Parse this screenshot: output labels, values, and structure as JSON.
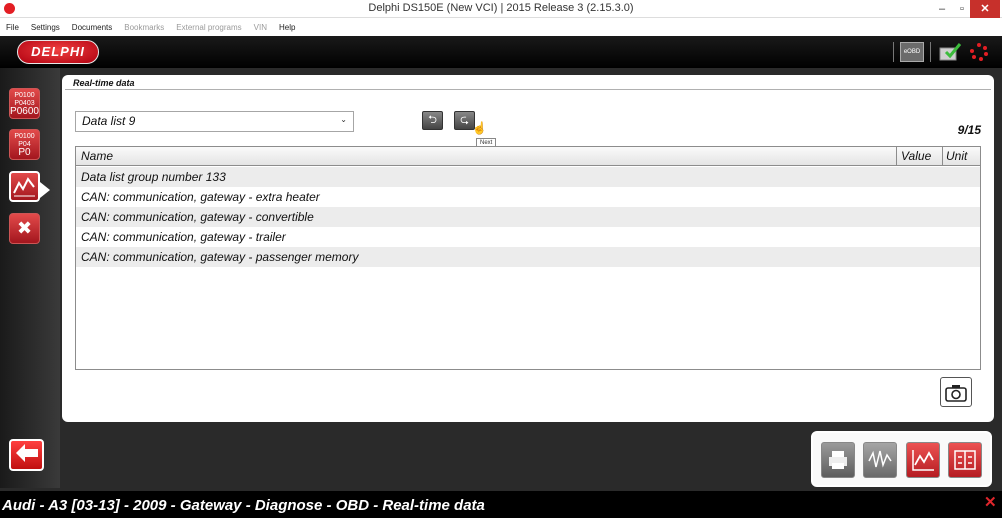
{
  "window": {
    "title": "Delphi DS150E (New VCI) | 2015 Release 3 (2.15.3.0)",
    "minimize": "–",
    "maximize": "▫",
    "close": "✕"
  },
  "menu": {
    "items": [
      {
        "label": "File",
        "enabled": true
      },
      {
        "label": "Settings",
        "enabled": true
      },
      {
        "label": "Documents",
        "enabled": true
      },
      {
        "label": "Bookmarks",
        "enabled": false
      },
      {
        "label": "External programs",
        "enabled": false
      },
      {
        "label": "VIN",
        "enabled": false
      },
      {
        "label": "Help",
        "enabled": true
      }
    ]
  },
  "header": {
    "logo": "DELPHI",
    "eobd_label": "eOBD",
    "accent": "#e31e24"
  },
  "sidebar": {
    "dtc1": {
      "line1": "P0100",
      "line2": "P0403",
      "line3": "P0600"
    },
    "dtc2": {
      "line1": "P0100",
      "line2": "P04",
      "line3": "P0"
    },
    "tool_glyph": "✖"
  },
  "main": {
    "section_title": "Real-time data",
    "datalist": {
      "selected": "Data list 9"
    },
    "prev_glyph": "⮌",
    "next_glyph": "⮎",
    "tooltip": "Next",
    "page_count": "9/15",
    "table": {
      "columns": [
        "Name",
        "Value",
        "Unit"
      ],
      "rows": [
        "Data list group number 133",
        "CAN: communication, gateway - extra heater",
        "CAN: communication, gateway - convertible",
        "CAN: communication, gateway - trailer",
        "CAN: communication, gateway - passenger memory"
      ]
    }
  },
  "statusbar": {
    "path": "Audi - A3 [03-13] - 2009 - Gateway - Diagnose - OBD - Real-time data",
    "close": "✕"
  }
}
